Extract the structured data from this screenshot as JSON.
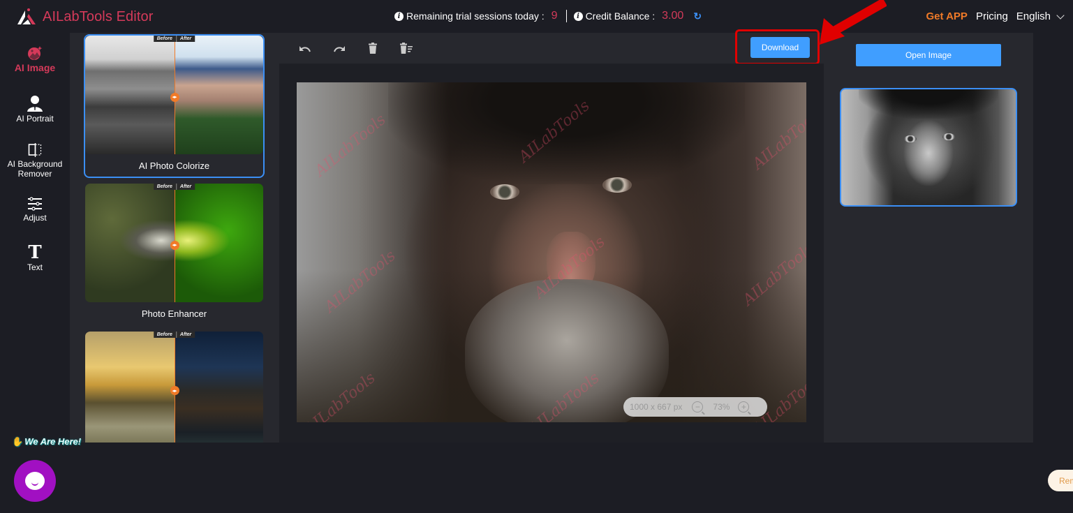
{
  "header": {
    "app_title": "AILabTools Editor",
    "trial_label": "Remaining trial sessions today :",
    "trial_value": "9",
    "credit_label": "Credit Balance :",
    "credit_value": "3.00",
    "get_app": "Get APP",
    "pricing": "Pricing",
    "language": "English"
  },
  "leftnav": {
    "items": [
      {
        "label": "AI Image",
        "icon": "ai-image-icon",
        "active": true
      },
      {
        "label": "AI Portrait",
        "icon": "portrait-icon"
      },
      {
        "label": "AI Background Remover",
        "label_line1": "AI Background",
        "label_line2": "Remover",
        "icon": "background-remover-icon"
      },
      {
        "label": "Adjust",
        "icon": "sliders-icon"
      },
      {
        "label": "Text",
        "icon": "text-icon"
      }
    ]
  },
  "templates": {
    "before_label": "Before",
    "after_label": "After",
    "items": [
      {
        "label": "AI Photo Colorize",
        "selected": true
      },
      {
        "label": "Photo Enhancer"
      },
      {
        "label": ""
      }
    ]
  },
  "toolbar": {
    "undo": "undo-icon",
    "redo": "redo-icon",
    "delete": "trash-icon",
    "clear_all": "clear-all-icon",
    "download_label": "Download"
  },
  "canvas": {
    "dimensions": "1000 x 667 px",
    "zoom_percent": "73%",
    "watermark": "AILabTools"
  },
  "rightpanel": {
    "open_image_label": "Open Image"
  },
  "chat_widget": {
    "text": "We Are Here!"
  },
  "remind_pill": {
    "text": "Rem"
  },
  "colors": {
    "accent_blue": "#409eff",
    "brand_red": "#d53a5a",
    "get_app_orange": "#f07a28",
    "annotation_red": "#e00000",
    "chat_purple": "#a110c2"
  }
}
